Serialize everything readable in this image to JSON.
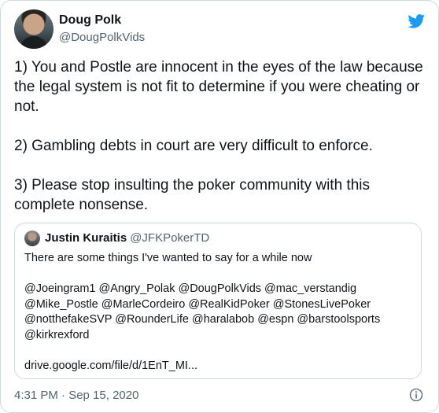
{
  "tweet": {
    "author_name": "Doug Polk",
    "author_handle": "@DougPolkVids",
    "text": "1) You and Postle are innocent in the eyes of the law because the legal system is not fit to determine if you were cheating or not.\n\n2) Gambling debts in court are very difficult to enforce.\n\n3) Please stop insulting the poker community with this complete nonsense.",
    "timestamp": "4:31 PM · Sep 15, 2020",
    "brand_color": "#1d9bf0"
  },
  "quoted_tweet": {
    "author_name": "Justin Kuraitis",
    "author_handle": "@JFKPokerTD",
    "text": "There are some things I've wanted to say for a while now\n\n@Joeingram1 @Angry_Polak @DougPolkVids @mac_verstandig @Mike_Postle @MarleCordeiro @RealKidPoker @StonesLivePoker @notthefakeSVP @RounderLife @haralabob @espn @barstoolsports @kirkrexford\n\ndrive.google.com/file/d/1EnT_MI..."
  },
  "icons": {
    "brand": "twitter-bird-icon",
    "info": "info-icon"
  }
}
